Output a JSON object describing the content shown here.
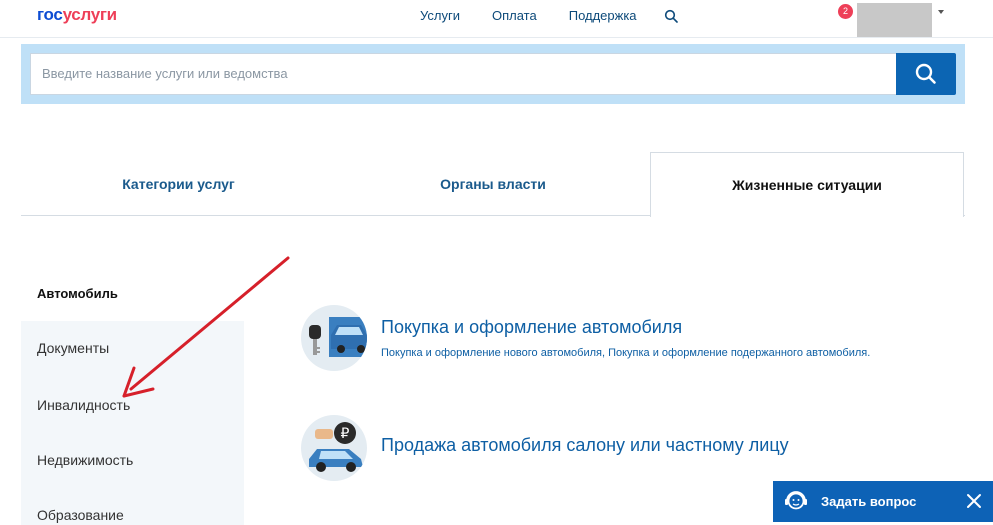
{
  "header": {
    "logo_part1": "гос",
    "logo_part2": "услуги",
    "nav": [
      "Услуги",
      "Оплата",
      "Поддержка"
    ],
    "notifications_count": "2"
  },
  "search": {
    "placeholder": "Введите название услуги или ведомства"
  },
  "tabs": [
    {
      "label": "Категории услуг"
    },
    {
      "label": "Органы власти"
    },
    {
      "label": "Жизненные ситуации",
      "active": true
    }
  ],
  "sidebar": {
    "title": "Автомобиль",
    "items": [
      "Документы",
      "Инвалидность",
      "Недвижимость",
      "Образование"
    ]
  },
  "services": [
    {
      "title": "Покупка и оформление автомобиля",
      "subtitle": "Покупка и оформление нового автомобиля, Покупка и оформление подержанного автомобиля."
    },
    {
      "title": "Продажа автомобиля салону или частному лицу"
    }
  ],
  "chat": {
    "label": "Задать вопрос"
  },
  "colors": {
    "brand_blue": "#0d4cd3",
    "brand_red": "#ee3f58",
    "accent_button": "#0c65b3",
    "annotation_arrow": "#d6202a"
  }
}
